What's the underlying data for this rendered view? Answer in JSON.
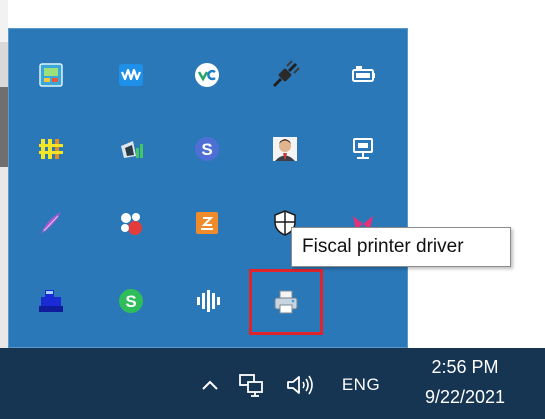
{
  "tray": {
    "icons": [
      {
        "name": "monitor-tool-icon"
      },
      {
        "name": "waveform-app-icon"
      },
      {
        "name": "vc-app-icon"
      },
      {
        "name": "power-plug-icon"
      },
      {
        "name": "battery-charging-icon"
      },
      {
        "name": "yellow-grid-app-icon"
      },
      {
        "name": "flag-signal-icon"
      },
      {
        "name": "s-blue-app-icon"
      },
      {
        "name": "user-avatar-app-icon"
      },
      {
        "name": "network-monitor-icon"
      },
      {
        "name": "feather-app-icon"
      },
      {
        "name": "color-dots-app-icon"
      },
      {
        "name": "orange-app-icon"
      },
      {
        "name": "security-shield-icon"
      },
      {
        "name": "pink-ribbon-app-icon"
      },
      {
        "name": "cash-register-icon"
      },
      {
        "name": "s-green-app-icon"
      },
      {
        "name": "audio-bars-app-icon"
      },
      {
        "name": "fiscal-printer-icon"
      }
    ],
    "highlighted_icon": "fiscal-printer-icon",
    "tooltip": "Fiscal printer driver"
  },
  "taskbar": {
    "chevron_icon": "chevron-up-icon",
    "network_icon": "network-icon",
    "volume_icon": "volume-icon",
    "language": "ENG",
    "time": "2:56 PM",
    "date": "9/22/2021"
  },
  "colors": {
    "tray_panel": "#2b78b8",
    "taskbar": "#163552",
    "highlight": "#e0242b",
    "tooltip_bg": "#ffffff"
  }
}
